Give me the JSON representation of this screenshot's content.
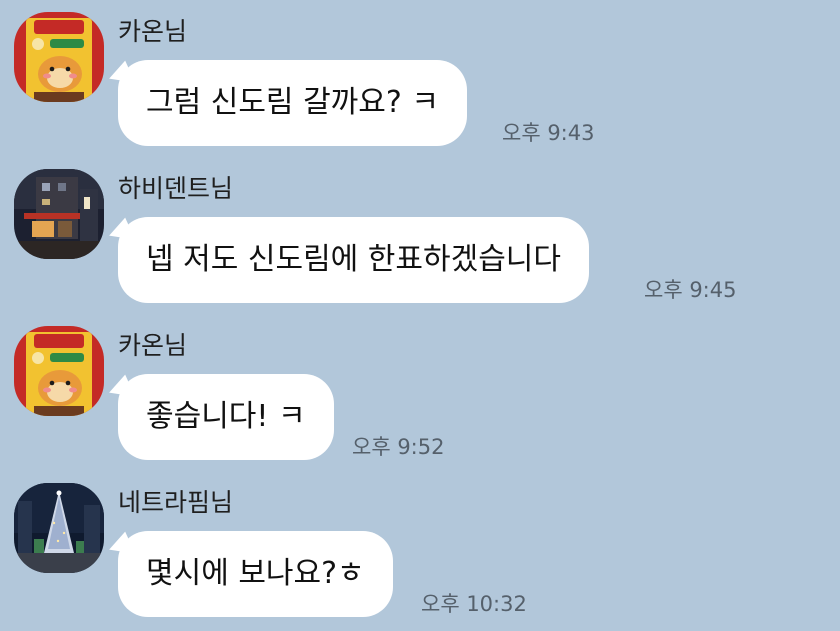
{
  "messages": [
    {
      "sender": "카온님",
      "avatar_icon": "yellow-character-avatar-icon",
      "text": "그럼 신도림 갈까요? ㅋ",
      "time": "오후 9:43"
    },
    {
      "sender": "하비덴트님",
      "avatar_icon": "night-street-avatar-icon",
      "text": "넵 저도 신도림에 한표하겠습니다",
      "time": "오후 9:45"
    },
    {
      "sender": "카온님",
      "avatar_icon": "yellow-character-avatar-icon",
      "text": "좋습니다! ㅋ",
      "time": "오후 9:52"
    },
    {
      "sender": "네트라핌님",
      "avatar_icon": "christmas-tree-avatar-icon",
      "text": "몇시에 보나요?ㅎ",
      "time": "오후 10:32"
    }
  ],
  "colors": {
    "background": "#b2c7da",
    "bubble": "#ffffff",
    "avatar_yellow": "#f2c230",
    "time_text": "#55606b"
  }
}
